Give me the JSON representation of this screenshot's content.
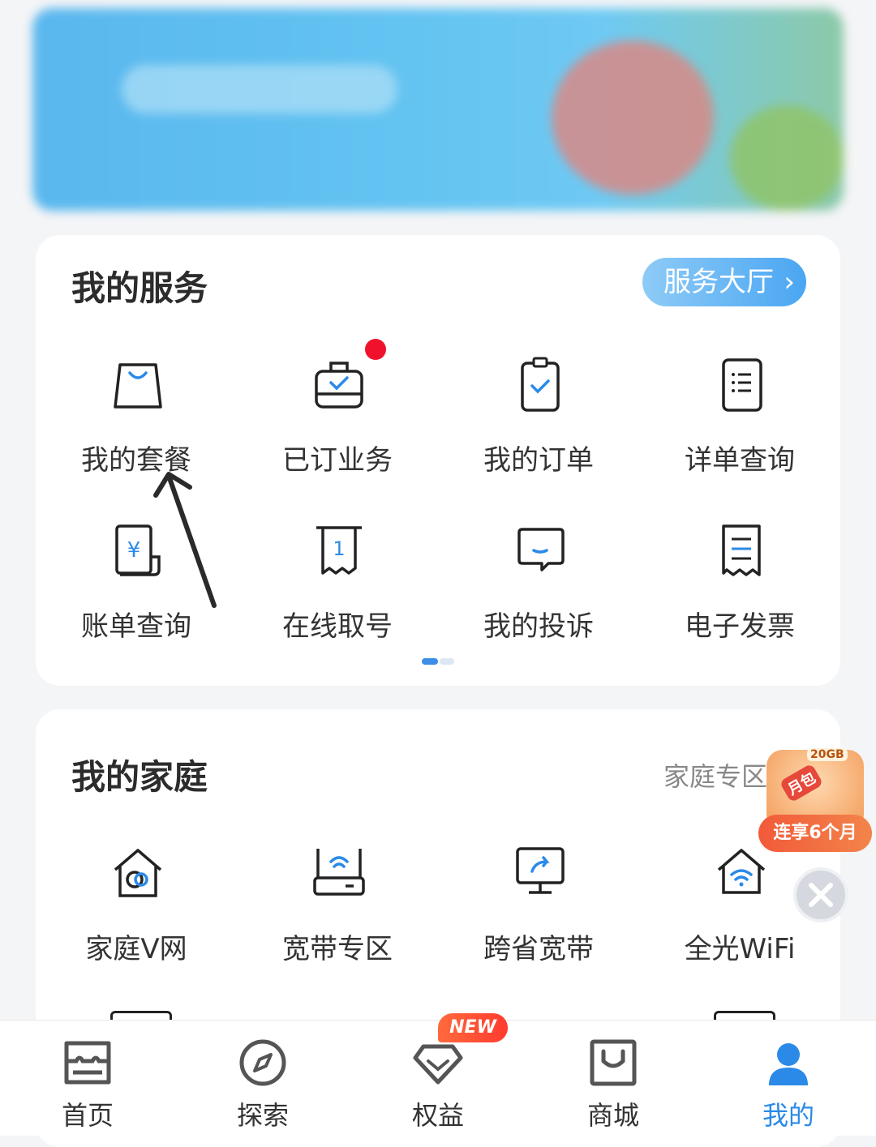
{
  "services": {
    "title": "我的服务",
    "hall_button": "服务大厅",
    "hall_chevron": "›",
    "items": [
      {
        "label": "我的套餐",
        "icon": "shopping-bag-icon"
      },
      {
        "label": "已订业务",
        "icon": "briefcase-check-icon",
        "badge": "red-dot"
      },
      {
        "label": "我的订单",
        "icon": "clipboard-check-icon"
      },
      {
        "label": "详单查询",
        "icon": "list-document-icon"
      },
      {
        "label": "账单查询",
        "icon": "yuan-bill-icon"
      },
      {
        "label": "在线取号",
        "icon": "queue-ticket-icon"
      },
      {
        "label": "我的投诉",
        "icon": "chat-bubble-icon"
      },
      {
        "label": "电子发票",
        "icon": "invoice-icon"
      }
    ],
    "page_count": 2,
    "current_page": 1
  },
  "family": {
    "title": "我的家庭",
    "link": "家庭专区",
    "items": [
      {
        "label": "家庭V网",
        "icon": "home-network-icon"
      },
      {
        "label": "宽带专区",
        "icon": "router-icon"
      },
      {
        "label": "跨省宽带",
        "icon": "screen-share-icon"
      },
      {
        "label": "全光WiFi",
        "icon": "home-wifi-icon"
      }
    ]
  },
  "promo": {
    "tag": "连享6个月",
    "gb": "20GB",
    "month": "月包"
  },
  "tabbar": {
    "tabs": [
      {
        "label": "首页",
        "icon": "home-store-icon"
      },
      {
        "label": "探索",
        "icon": "compass-icon"
      },
      {
        "label": "权益",
        "icon": "diamond-icon"
      },
      {
        "label": "商城",
        "icon": "shopping-bag-icon"
      },
      {
        "label": "我的",
        "icon": "user-icon",
        "active": true
      }
    ],
    "new_badge": "NEW"
  },
  "colors": {
    "accent": "#2b8ae8",
    "badge_red": "#f0122d",
    "promo_orange": "#f25a3a"
  }
}
